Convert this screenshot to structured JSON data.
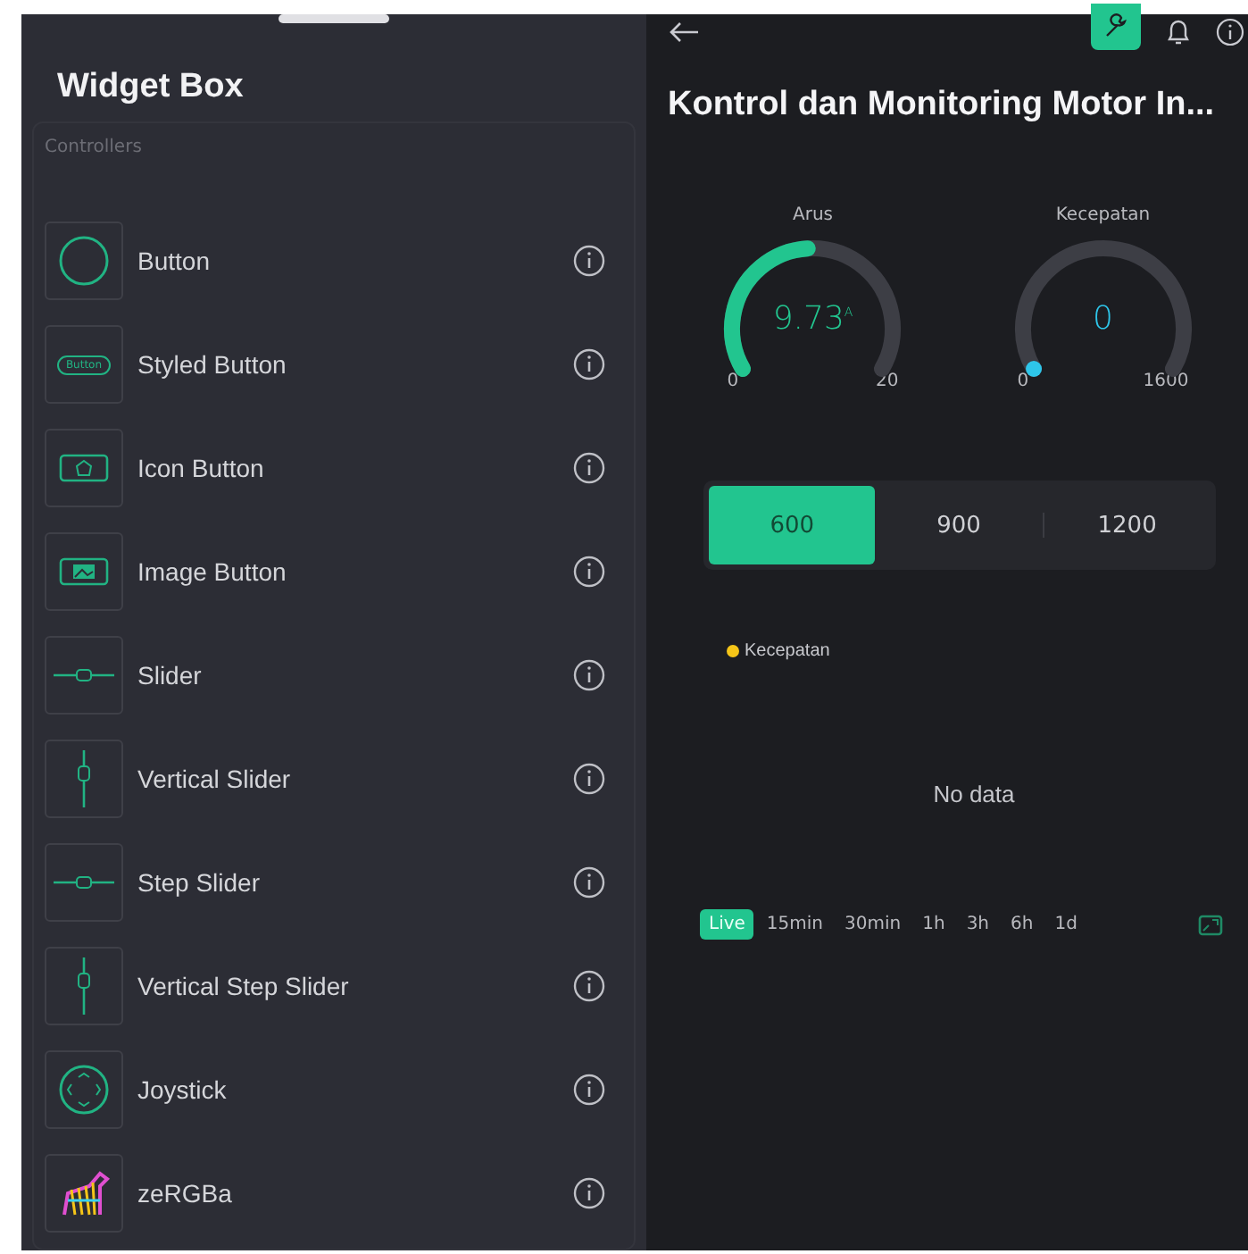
{
  "widget_box": {
    "title": "Widget Box",
    "section": "Controllers",
    "items": [
      {
        "label": "Button",
        "kind": "button"
      },
      {
        "label": "Styled Button",
        "kind": "styled",
        "icon_text": "Button"
      },
      {
        "label": "Icon Button",
        "kind": "icon"
      },
      {
        "label": "Image Button",
        "kind": "image"
      },
      {
        "label": "Slider",
        "kind": "hslider"
      },
      {
        "label": "Vertical Slider",
        "kind": "vslider"
      },
      {
        "label": "Step Slider",
        "kind": "hslider"
      },
      {
        "label": "Vertical Step Slider",
        "kind": "vslider"
      },
      {
        "label": "Joystick",
        "kind": "joystick"
      },
      {
        "label": "zeRGBa",
        "kind": "zergba"
      }
    ]
  },
  "dashboard": {
    "title": "Kontrol dan Monitoring Motor In...",
    "gauges": [
      {
        "label": "Arus",
        "value": "9.73",
        "unit": "A",
        "min": "0",
        "max": "20",
        "color": "#22c58f"
      },
      {
        "label": "Kecepatan",
        "value": "0",
        "min": "0",
        "max": "1600",
        "color": "#2ec6ea"
      }
    ],
    "segments": [
      {
        "label": "600",
        "selected": true
      },
      {
        "label": "900",
        "selected": false
      },
      {
        "label": "1200",
        "selected": false
      }
    ],
    "chart": {
      "legend": [
        {
          "label": "Kecepatan",
          "color": "#f5c518"
        }
      ],
      "message": "No data"
    },
    "ranges": [
      {
        "label": "Live",
        "selected": true
      },
      {
        "label": "15min",
        "selected": false
      },
      {
        "label": "30min",
        "selected": false
      },
      {
        "label": "1h",
        "selected": false
      },
      {
        "label": "3h",
        "selected": false
      },
      {
        "label": "6h",
        "selected": false
      },
      {
        "label": "1d",
        "selected": false
      }
    ]
  }
}
